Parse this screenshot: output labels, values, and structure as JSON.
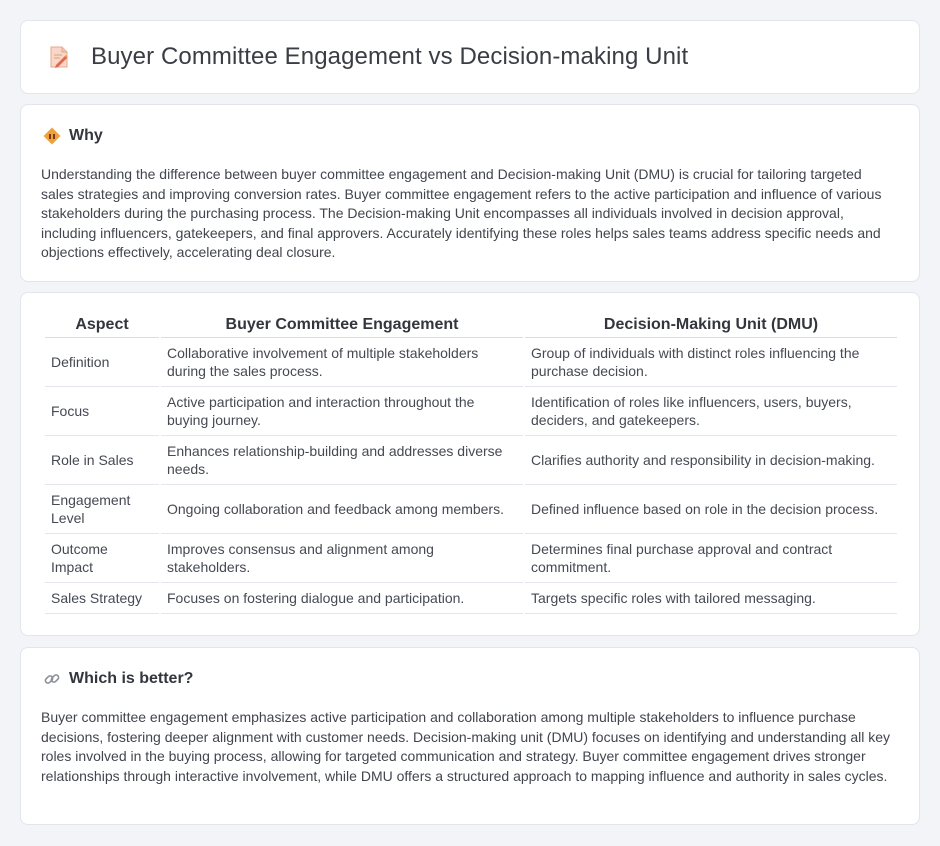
{
  "header": {
    "title": "Buyer Committee Engagement vs Decision-making Unit",
    "icon": "document-pencil-icon"
  },
  "why": {
    "heading": "Why",
    "icon": "diamond-info-icon",
    "text": "Understanding the difference between buyer committee engagement and Decision-making Unit (DMU) is crucial for tailoring targeted sales strategies and improving conversion rates. Buyer committee engagement refers to the active participation and influence of various stakeholders during the purchasing process. The Decision-making Unit encompasses all individuals involved in decision approval, including influencers, gatekeepers, and final approvers. Accurately identifying these roles helps sales teams address specific needs and objections effectively, accelerating deal closure."
  },
  "comparison": {
    "headers": [
      "Aspect",
      "Buyer Committee Engagement",
      "Decision-Making Unit (DMU)"
    ],
    "rows": [
      [
        "Definition",
        "Collaborative involvement of multiple stakeholders during the sales process.",
        "Group of individuals with distinct roles influencing the purchase decision."
      ],
      [
        "Focus",
        "Active participation and interaction throughout the buying journey.",
        "Identification of roles like influencers, users, buyers, deciders, and gatekeepers."
      ],
      [
        "Role in Sales",
        "Enhances relationship-building and addresses diverse needs.",
        "Clarifies authority and responsibility in decision-making."
      ],
      [
        "Engagement Level",
        "Ongoing collaboration and feedback among members.",
        "Defined influence based on role in the decision process."
      ],
      [
        "Outcome Impact",
        "Improves consensus and alignment among stakeholders.",
        "Determines final purchase approval and contract commitment."
      ],
      [
        "Sales Strategy",
        "Focuses on fostering dialogue and participation.",
        "Targets specific roles with tailored messaging."
      ]
    ]
  },
  "better": {
    "heading": "Which is better?",
    "icon": "link-icon",
    "text": "Buyer committee engagement emphasizes active participation and collaboration among multiple stakeholders to influence purchase decisions, fostering deeper alignment with customer needs. Decision-making unit (DMU) focuses on identifying and understanding all key roles involved in the buying process, allowing for targeted communication and strategy. Buyer committee engagement drives stronger relationships through interactive involvement, while DMU offers a structured approach to mapping influence and authority in sales cycles."
  },
  "colors": {
    "background": "#f3f4f8",
    "card": "#ffffff",
    "accent_orange": "#f0a23a",
    "icon_red": "#e2674c"
  }
}
